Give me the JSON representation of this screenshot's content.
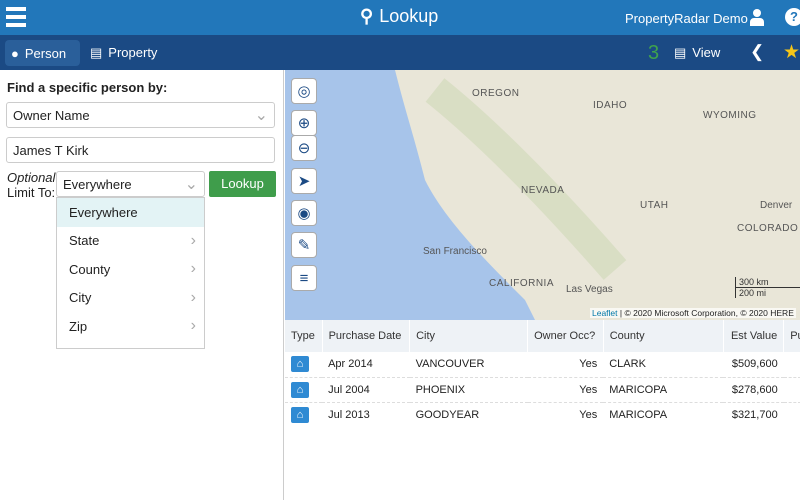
{
  "header": {
    "title": "Lookup",
    "account": "PropertyRadar Demo"
  },
  "subnav": {
    "tabs": [
      {
        "label": "Person"
      },
      {
        "label": "Property"
      }
    ],
    "count": "3",
    "view_label": "View"
  },
  "form": {
    "heading": "Find a specific person by:",
    "search_by": "Owner Name",
    "name_value": "James T Kirk",
    "optional_label": "Optional",
    "limit_label": "Limit To:",
    "limit_value": "Everywhere",
    "lookup_label": "Lookup"
  },
  "dropdown": {
    "options": [
      "Everywhere",
      "State",
      "County",
      "City",
      "Zip"
    ]
  },
  "map": {
    "labels": [
      "OREGON",
      "IDAHO",
      "WYOMING",
      "NEVADA",
      "UTAH",
      "Denver",
      "COLORADO",
      "San Francisco",
      "CALIFORNIA",
      "Las Vegas"
    ],
    "scale_km": "300 km",
    "scale_mi": "200 mi",
    "attribution_link": "Leaflet",
    "attribution": "| © 2020 Microsoft Corporation, © 2020 HERE"
  },
  "table": {
    "headers": [
      "Type",
      "Purchase Date",
      "City",
      "Owner Occ?",
      "County",
      "Est Value",
      "Pur"
    ],
    "rows": [
      [
        "Apr 2014",
        "VANCOUVER",
        "Yes",
        "CLARK",
        "$509,600"
      ],
      [
        "Jul 2004",
        "PHOENIX",
        "Yes",
        "MARICOPA",
        "$278,600"
      ],
      [
        "Jul 2013",
        "GOODYEAR",
        "Yes",
        "MARICOPA",
        "$321,700"
      ]
    ]
  }
}
